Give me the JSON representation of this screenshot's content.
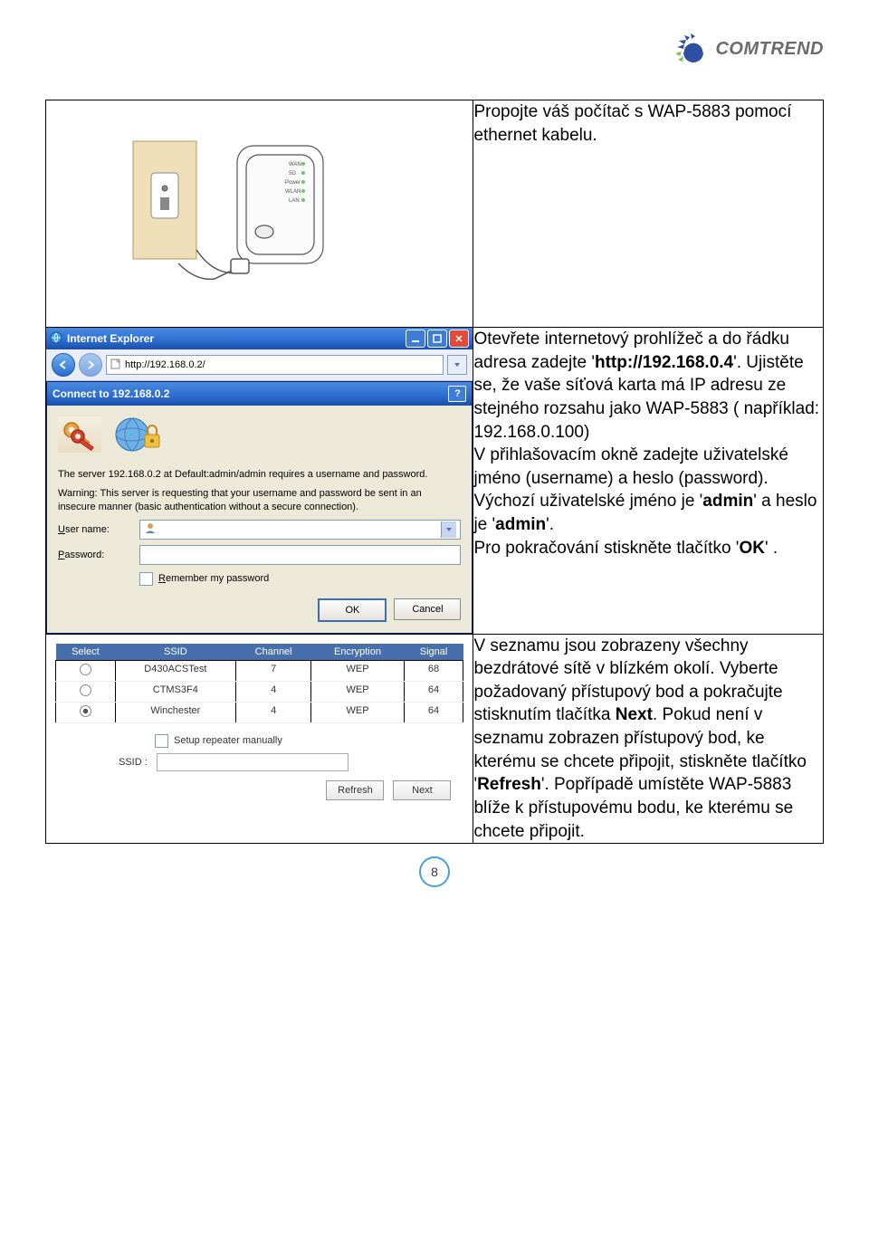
{
  "logo_text": "COMTREND",
  "row1": {
    "text": "Propojte váš počítač s WAP-5883 pomocí ethernet kabelu."
  },
  "row2": {
    "ie_title": "Internet Explorer",
    "address": "http://192.168.0.2/",
    "login_title": "Connect to 192.168.0.2",
    "server_text": "The server 192.168.0.2 at Default:admin/admin requires a username and password.",
    "warning_text": "Warning: This server is requesting that your username and password be sent in an insecure manner (basic authentication without a secure connection).",
    "user_label": "User name:",
    "pass_label": "Password:",
    "remember_label": "Remember my password",
    "ok": "OK",
    "cancel": "Cancel",
    "desc_part1": "Otevřete internetový prohlížeč a do řádku adresa zadejte '",
    "desc_url": "http://192.168.0.4",
    "desc_part2": "'. Ujistěte se, že vaše síťová karta má IP adresu ze stejného rozsahu jako WAP-5883 ( například: 192.168.0.100)",
    "desc_part3a": "V přihlašovacím okně zadejte uživatelské jméno (username) a heslo (password). Výchozí uživatelské jméno je '",
    "admin1": "admin",
    "desc_part3b": "' a heslo je '",
    "admin2": "admin",
    "desc_part3c": "'.",
    "desc_part4a": "Pro pokračování stiskněte tlačítko '",
    "ok_cz": "OK",
    "desc_part4b": "' ."
  },
  "row3": {
    "headers": [
      "Select",
      "SSID",
      "Channel",
      "Encryption",
      "Signal"
    ],
    "rows": [
      {
        "sel": false,
        "ssid": "D430ACSTest",
        "ch": "7",
        "enc": "WEP",
        "sig": "68"
      },
      {
        "sel": false,
        "ssid": "CTMS3F4",
        "ch": "4",
        "enc": "WEP",
        "sig": "64"
      },
      {
        "sel": true,
        "ssid": "Winchester",
        "ch": "4",
        "enc": "WEP",
        "sig": "64"
      }
    ],
    "setup_label": "Setup repeater manually",
    "ssid_label": "SSID :",
    "refresh": "Refresh",
    "next": "Next",
    "desc_a": "V seznamu jsou zobrazeny všechny bezdrátové sítě v blízkém okolí. Vyberte požadovaný přístupový bod a pokračujte stisknutím tlačítka ",
    "next_bold": "Next",
    "desc_b": ". Pokud není v seznamu zobrazen přístupový bod, ke kterému se chcete připojit, stiskněte tlačítko '",
    "refresh_bold": "Refresh",
    "desc_c": "'. Popřípadě umístěte WAP-5883 blíže k přístupovému bodu, ke kterému se chcete připojit."
  },
  "page_number": "8"
}
